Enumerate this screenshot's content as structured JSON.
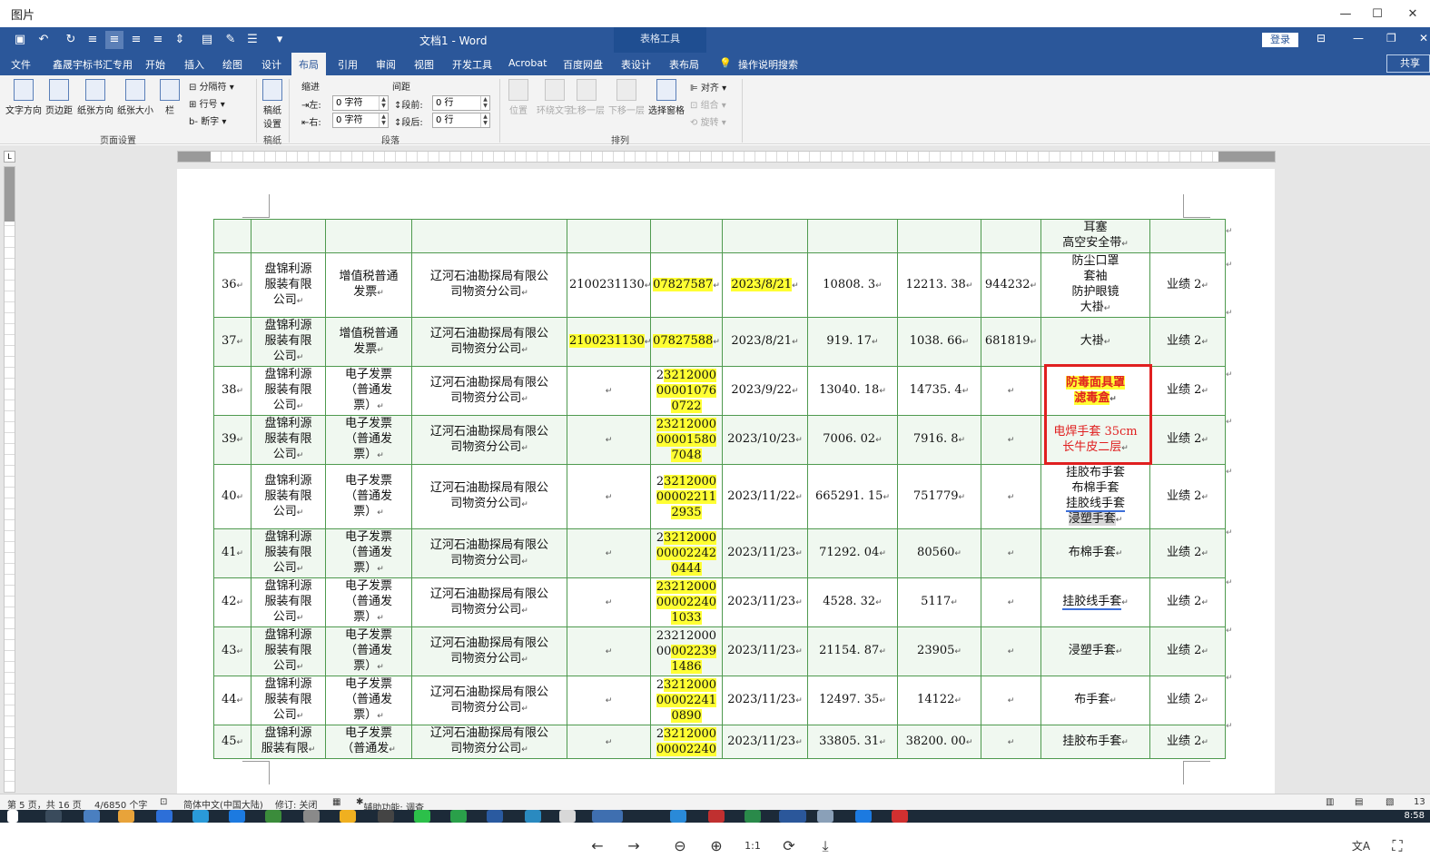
{
  "viewer": {
    "title": "图片",
    "minimize": "—",
    "maximize": "☐",
    "close": "✕",
    "controls": {
      "prev": "←",
      "next": "→",
      "zoom_out": "⊖",
      "zoom_in": "⊕",
      "actual_size": "1:1",
      "rotate": "⟳",
      "download": "⤓",
      "translate": "文A",
      "ocr": "⛶"
    }
  },
  "word": {
    "doc_title": "文档1 - Word",
    "table_tools": "表格工具",
    "login": "登录",
    "share": "共享",
    "tell_me": "操作说明搜索",
    "tabs": [
      "文件",
      "鑫晟宇标书汇专用",
      "开始",
      "插入",
      "绘图",
      "设计",
      "布局",
      "引用",
      "审阅",
      "视图",
      "开发工具",
      "Acrobat",
      "百度网盘",
      "表设计",
      "表布局"
    ],
    "active_tab": "布局",
    "ribbon": {
      "text_direction": "文字方向",
      "margins": "页边距",
      "orientation": "纸张方向",
      "size": "纸张大小",
      "columns": "栏",
      "breaks": "分隔符",
      "line_numbers": "行号",
      "hyphenation": "断字",
      "page_setup_group": "页面设置",
      "draft_settings": "稿纸设置",
      "draft_group": "稿纸",
      "indent_label": "缩进",
      "spacing_label": "间距",
      "indent_left_label": "左:",
      "indent_left_value": "0 字符",
      "indent_right_label": "右:",
      "indent_right_value": "0 字符",
      "space_before_label": "段前:",
      "space_before_value": "0 行",
      "space_after_label": "段后:",
      "space_after_value": "0 行",
      "paragraph_group": "段落",
      "position": "位置",
      "wrap_text": "环绕文字",
      "bring_forward": "上移一层",
      "send_backward": "下移一层",
      "selection_pane": "选择窗格",
      "align": "对齐",
      "group": "组合",
      "rotate": "旋转",
      "arrange_group": "排列"
    }
  },
  "table": {
    "top_row": {
      "product": [
        "耳塞",
        "高空安全带"
      ]
    },
    "rows": [
      {
        "no": "36",
        "seller": [
          "盘锦利源",
          "服装有限",
          "公司"
        ],
        "type": [
          "增值税普通",
          "发票"
        ],
        "buyer": [
          "辽河石油勘探局有限公",
          "司物资分公司"
        ],
        "code": "2100231130",
        "code_hl": false,
        "invoice": [
          "07827587"
        ],
        "invoice_hl": "all",
        "date": "2023/8/21",
        "date_hl": true,
        "amount": "10808. 3",
        "total": "12213. 38",
        "check": "944232",
        "product": [
          "防尘口罩",
          "套袖",
          "防护眼镜",
          "大褂"
        ],
        "note": "业绩 2"
      },
      {
        "no": "37",
        "seller": [
          "盘锦利源",
          "服装有限",
          "公司"
        ],
        "type": [
          "增值税普通",
          "发票"
        ],
        "buyer": [
          "辽河石油勘探局有限公",
          "司物资分公司"
        ],
        "code": "2100231130",
        "code_hl": true,
        "invoice": [
          "07827588"
        ],
        "invoice_hl": "all",
        "date": "2023/8/21",
        "date_hl": false,
        "amount": "919. 17",
        "total": "1038. 66",
        "check": "681819",
        "product": [
          "大褂"
        ],
        "note": "业绩 2"
      },
      {
        "no": "38",
        "seller": [
          "盘锦利源",
          "服装有限",
          "公司"
        ],
        "type": [
          "电子发票",
          "（普通发",
          "票）"
        ],
        "buyer": [
          "辽河石油勘探局有限公",
          "司物资分公司"
        ],
        "code": "",
        "code_hl": false,
        "invoice": [
          "23212000",
          "00001076",
          "0722"
        ],
        "invoice_hl": "skip1",
        "date": "2023/9/22",
        "date_hl": false,
        "amount": "13040. 18",
        "total": "14735. 4",
        "check": "",
        "product": [
          "防毒面具罩",
          "滤毒盒"
        ],
        "note": "业绩 2"
      },
      {
        "no": "39",
        "seller": [
          "盘锦利源",
          "服装有限",
          "公司"
        ],
        "type": [
          "电子发票",
          "（普通发",
          "票）"
        ],
        "buyer": [
          "辽河石油勘探局有限公",
          "司物资分公司"
        ],
        "code": "",
        "code_hl": false,
        "invoice": [
          "23212000",
          "00001580",
          "7048"
        ],
        "invoice_hl": "all",
        "date": "2023/10/23",
        "date_hl": false,
        "amount": "7006. 02",
        "total": "7916. 8",
        "check": "",
        "product": [
          "电焊手套 35cm",
          "长牛皮二层"
        ],
        "note": "业绩 2"
      },
      {
        "no": "40",
        "seller": [
          "盘锦利源",
          "服装有限",
          "公司"
        ],
        "type": [
          "电子发票",
          "（普通发",
          "票）"
        ],
        "buyer": [
          "辽河石油勘探局有限公",
          "司物资分公司"
        ],
        "code": "",
        "code_hl": false,
        "invoice": [
          "23212000",
          "00002211",
          "2935"
        ],
        "invoice_hl": "skip1",
        "date": "2023/11/22",
        "date_hl": false,
        "amount": "665291. 15",
        "total": "751779",
        "check": "",
        "product": [
          "挂胶布手套",
          "布棉手套",
          "挂胶线手套",
          "浸塑手套"
        ],
        "note": "业绩 2"
      },
      {
        "no": "41",
        "seller": [
          "盘锦利源",
          "服装有限",
          "公司"
        ],
        "type": [
          "电子发票",
          "（普通发",
          "票）"
        ],
        "buyer": [
          "辽河石油勘探局有限公",
          "司物资分公司"
        ],
        "code": "",
        "code_hl": false,
        "invoice": [
          "23212000",
          "00002242",
          "0444"
        ],
        "invoice_hl": "skip1",
        "date": "2023/11/23",
        "date_hl": false,
        "amount": "71292. 04",
        "total": "80560",
        "check": "",
        "product": [
          "布棉手套"
        ],
        "note": "业绩 2"
      },
      {
        "no": "42",
        "seller": [
          "盘锦利源",
          "服装有限",
          "公司"
        ],
        "type": [
          "电子发票",
          "（普通发",
          "票）"
        ],
        "buyer": [
          "辽河石油勘探局有限公",
          "司物资分公司"
        ],
        "code": "",
        "code_hl": false,
        "invoice": [
          "23212000",
          "00002240",
          "1033"
        ],
        "invoice_hl": "all",
        "date": "2023/11/23",
        "date_hl": false,
        "amount": "4528.  32",
        "total": "5117",
        "check": "",
        "product": [
          "挂胶线手套"
        ],
        "note": "业绩 2"
      },
      {
        "no": "43",
        "seller": [
          "盘锦利源",
          "服装有限",
          "公司"
        ],
        "type": [
          "电子发票",
          "（普通发",
          "票）"
        ],
        "buyer": [
          "辽河石油勘探局有限公",
          "司物资分公司"
        ],
        "code": "",
        "code_hl": false,
        "invoice": [
          "23212000",
          "00002239",
          "1486"
        ],
        "invoice_hl": "partial",
        "date": "2023/11/23",
        "date_hl": false,
        "amount": "21154. 87",
        "total": "23905",
        "check": "",
        "product": [
          "浸塑手套"
        ],
        "note": "业绩 2"
      },
      {
        "no": "44",
        "seller": [
          "盘锦利源",
          "服装有限",
          "公司"
        ],
        "type": [
          "电子发票",
          "（普通发",
          "票）"
        ],
        "buyer": [
          "辽河石油勘探局有限公",
          "司物资分公司"
        ],
        "code": "",
        "code_hl": false,
        "invoice": [
          "23212000",
          "00002241",
          "0890"
        ],
        "invoice_hl": "skip1",
        "date": "2023/11/23",
        "date_hl": false,
        "amount": "12497. 35",
        "total": "14122",
        "check": "",
        "product": [
          "布手套"
        ],
        "note": "业绩 2"
      },
      {
        "no": "45",
        "seller": [
          "盘锦利源",
          "服装有限"
        ],
        "type": [
          "电子发票",
          "（普通发"
        ],
        "buyer": [
          "辽河石油勘探局有限公",
          "司物资分公司"
        ],
        "code": "",
        "code_hl": false,
        "invoice": [
          "23212000",
          "00002240"
        ],
        "invoice_hl": "skip1",
        "date": "2023/11/23",
        "date_hl": false,
        "amount": "33805. 31",
        "total": "38200.  00",
        "check": "",
        "product": [
          "挂胶布手套"
        ],
        "note": "业绩 2"
      }
    ]
  },
  "status": {
    "page": "第 5 页，共 16 页",
    "words": "4/6850 个字",
    "language": "简体中文(中国大陆)",
    "track_changes": "修订: 关闭",
    "accessibility": "辅助功能: 调查",
    "zoom": "13"
  },
  "taskbar": {
    "clock": "8:58"
  },
  "colors": {
    "word_blue": "#2b579a",
    "table_border": "#4f9a4f",
    "highlight": "#ffff33",
    "annotation_red": "#e02020"
  }
}
